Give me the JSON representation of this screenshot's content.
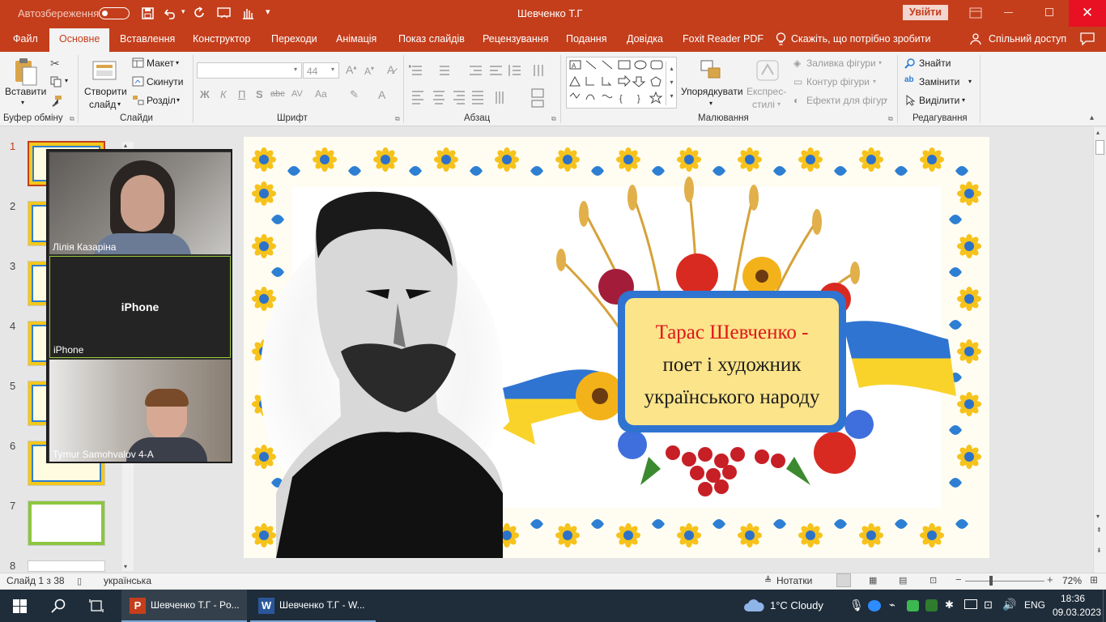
{
  "titlebar": {
    "autosave_label": "Автозбереження",
    "autosave_state": "Вимк.",
    "title": "Шевченко Т.Г",
    "signin_label": "Увійти",
    "accent": "#c43e1c"
  },
  "tabs": [
    {
      "label": "Файл"
    },
    {
      "label": "Основне"
    },
    {
      "label": "Вставлення"
    },
    {
      "label": "Конструктор"
    },
    {
      "label": "Переходи"
    },
    {
      "label": "Анімація"
    },
    {
      "label": "Показ слайдів"
    },
    {
      "label": "Рецензування"
    },
    {
      "label": "Подання"
    },
    {
      "label": "Довідка"
    },
    {
      "label": "Foxit Reader PDF"
    }
  ],
  "tellme": "Скажіть, що потрібно зробити",
  "share_label": "Спільний доступ",
  "ribbon": {
    "clipboard": {
      "paste": "Вставити",
      "group": "Буфер обміну"
    },
    "slides": {
      "new_slide": "Створити",
      "new_slide2": "слайд",
      "layout": "Макет",
      "reset": "Скинути",
      "section": "Розділ",
      "group": "Слайди"
    },
    "font": {
      "font_name": "",
      "font_size": "44",
      "bold": "Ж",
      "italic": "К",
      "underline": "П",
      "shadow": "S",
      "strike": "abc",
      "spacing": "AV",
      "case": "Aa",
      "group": "Шрифт"
    },
    "paragraph": {
      "group": "Абзац"
    },
    "drawing": {
      "arrange": "Упорядкувати",
      "quick_styles": "Експрес-",
      "quick_styles2": "стилі",
      "fill": "Заливка фігури",
      "outline": "Контур фігури",
      "effects": "Ефекти для фігур",
      "group": "Малювання"
    },
    "editing": {
      "find": "Знайти",
      "replace": "Замінити",
      "select": "Виділити",
      "group": "Редагування"
    }
  },
  "thumbnails": [
    {
      "num": "1"
    },
    {
      "num": "2"
    },
    {
      "num": "3"
    },
    {
      "num": "4"
    },
    {
      "num": "5"
    },
    {
      "num": "6"
    },
    {
      "num": "7"
    },
    {
      "num": "8"
    }
  ],
  "video": {
    "tiles": [
      {
        "name": "Лілія Казаріна",
        "center": ""
      },
      {
        "name": "iPhone",
        "center": "iPhone"
      },
      {
        "name": "Tymur Samohvalov 4-A",
        "center": ""
      }
    ]
  },
  "slide": {
    "title_red": "Тарас Шевченко",
    "title_dash": " -",
    "line2": "поет і художник",
    "line3": "українського народу"
  },
  "status": {
    "slide_of": "Слайд 1 з 38",
    "language": "українська",
    "notes": "Нотатки",
    "zoom": "72%"
  },
  "taskbar": {
    "app1": "Шевченко Т.Г - Po...",
    "app2": "Шевченко Т.Г - W...",
    "weather": "1°C  Cloudy",
    "lang": "ENG",
    "time": "18:36",
    "date": "09.03.2023"
  }
}
